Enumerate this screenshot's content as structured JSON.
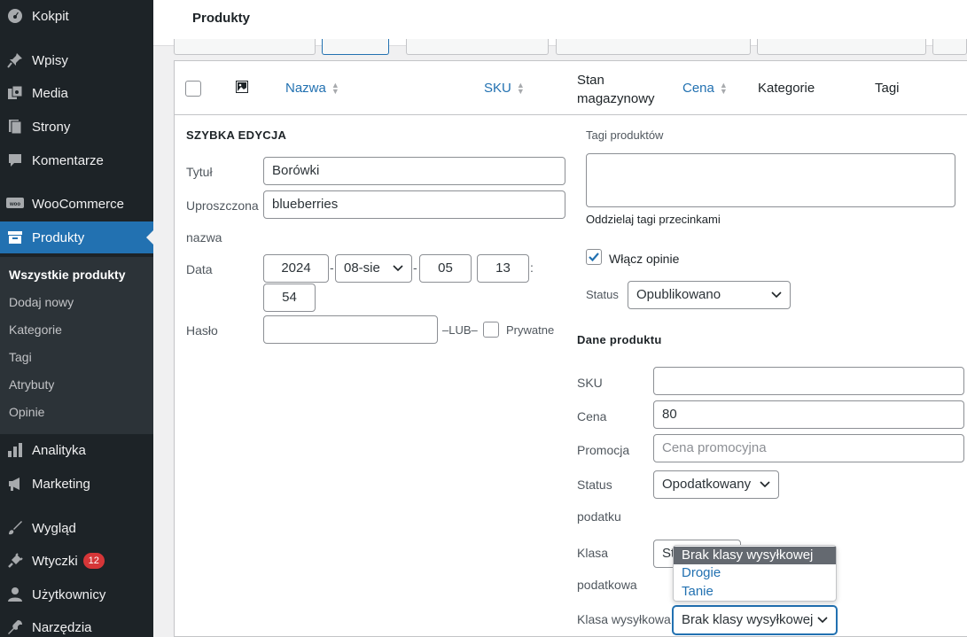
{
  "sidebar": {
    "items": [
      {
        "label": "Kokpit",
        "icon": "dashboard-icon"
      },
      {
        "label": "Wpisy",
        "icon": "pin-icon"
      },
      {
        "label": "Media",
        "icon": "media-icon"
      },
      {
        "label": "Strony",
        "icon": "pages-icon"
      },
      {
        "label": "Komentarze",
        "icon": "comments-icon"
      },
      {
        "label": "WooCommerce",
        "icon": "woo-icon"
      },
      {
        "label": "Produkty",
        "icon": "archive-icon"
      },
      {
        "label": "Analityka",
        "icon": "chart-icon"
      },
      {
        "label": "Marketing",
        "icon": "megaphone-icon"
      },
      {
        "label": "Wygląd",
        "icon": "brush-icon"
      },
      {
        "label": "Wtyczki",
        "icon": "plugin-icon",
        "badge": "12"
      },
      {
        "label": "Użytkownicy",
        "icon": "user-icon"
      },
      {
        "label": "Narzędzia",
        "icon": "wrench-icon"
      }
    ],
    "submenu": [
      "Wszystkie produkty",
      "Dodaj nowy",
      "Kategorie",
      "Tagi",
      "Atrybuty",
      "Opinie"
    ]
  },
  "header": {
    "title": "Produkty"
  },
  "table": {
    "columns": {
      "name": "Nazwa",
      "sku": "SKU",
      "stock_line1": "Stan",
      "stock_line2": "magazynowy",
      "price": "Cena",
      "categories": "Kategorie",
      "tags": "Tagi"
    }
  },
  "quick_edit": {
    "heading": "SZYBKA EDYCJA",
    "title_label": "Tytuł",
    "title_value": "Borówki",
    "slug_label_line1": "Uproszczona",
    "slug_label_line2": "nazwa",
    "slug_value": "blueberries",
    "date_label": "Data",
    "date_year": "2024",
    "date_month": "08-sie",
    "date_day": "05",
    "date_hour": "13",
    "date_minute": "54",
    "date_sep1": "-",
    "date_sep2": "-",
    "date_sep3": ":",
    "password_label": "Hasło",
    "password_value": "",
    "or_text": "–LUB–",
    "private_label": "Prywatne",
    "tags_label": "Tagi produktów",
    "tags_value": "",
    "tags_hint": "Oddzielaj tagi przecinkami",
    "comments_label": "Włącz opinie",
    "status_label": "Status",
    "status_value": "Opublikowano",
    "product_data_heading": "Dane produktu",
    "sku_label": "SKU",
    "sku_value": "",
    "price_label": "Cena",
    "price_value": "80",
    "sale_label": "Promocja",
    "sale_placeholder": "Cena promocyjna",
    "tax_status_label_line1": "Status",
    "tax_status_label_line2": "podatku",
    "tax_status_value": "Opodatkowany",
    "tax_class_label_line1": "Klasa",
    "tax_class_label_line2": "podatkowa",
    "tax_class_value": "St",
    "shipping_class_label": "Klasa wysyłkowa",
    "shipping_class_value": "Brak klasy wysyłkowej",
    "shipping_class_options": [
      "Brak klasy wysyłkowej",
      "Drogie",
      "Tanie"
    ]
  },
  "colors": {
    "accent": "#2271b1",
    "sidebar_bg": "#1d2327",
    "badge": "#d63638"
  }
}
